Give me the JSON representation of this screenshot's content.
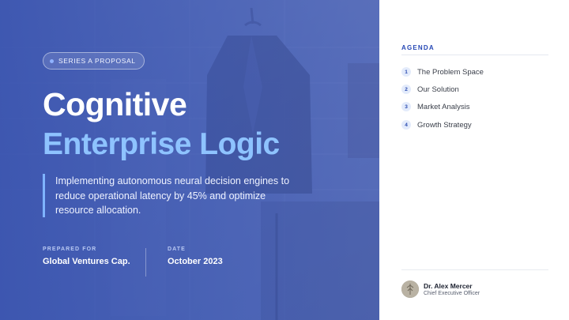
{
  "hero": {
    "tag": "SERIES A PROPOSAL",
    "title_line1": "Cognitive",
    "title_line2": "Enterprise Logic",
    "description": "Implementing autonomous neural decision engines to reduce operational latency by 45% and optimize resource allocation.",
    "prepared_for_label": "PREPARED FOR",
    "prepared_for_value": "Global Ventures Cap.",
    "date_label": "DATE",
    "date_value": "October 2023"
  },
  "agenda": {
    "title": "AGENDA",
    "items": [
      {
        "number": "1",
        "label": "The Problem Space"
      },
      {
        "number": "2",
        "label": "Our Solution"
      },
      {
        "number": "3",
        "label": "Market Analysis"
      },
      {
        "number": "4",
        "label": "Growth Strategy"
      }
    ]
  },
  "author": {
    "name": "Dr. Alex Mercer",
    "role": "Chief Executive Officer"
  },
  "colors": {
    "hero_blue": "#4f66b8",
    "title_accent": "#8ec3ff",
    "agenda_accent": "#2648b5"
  }
}
